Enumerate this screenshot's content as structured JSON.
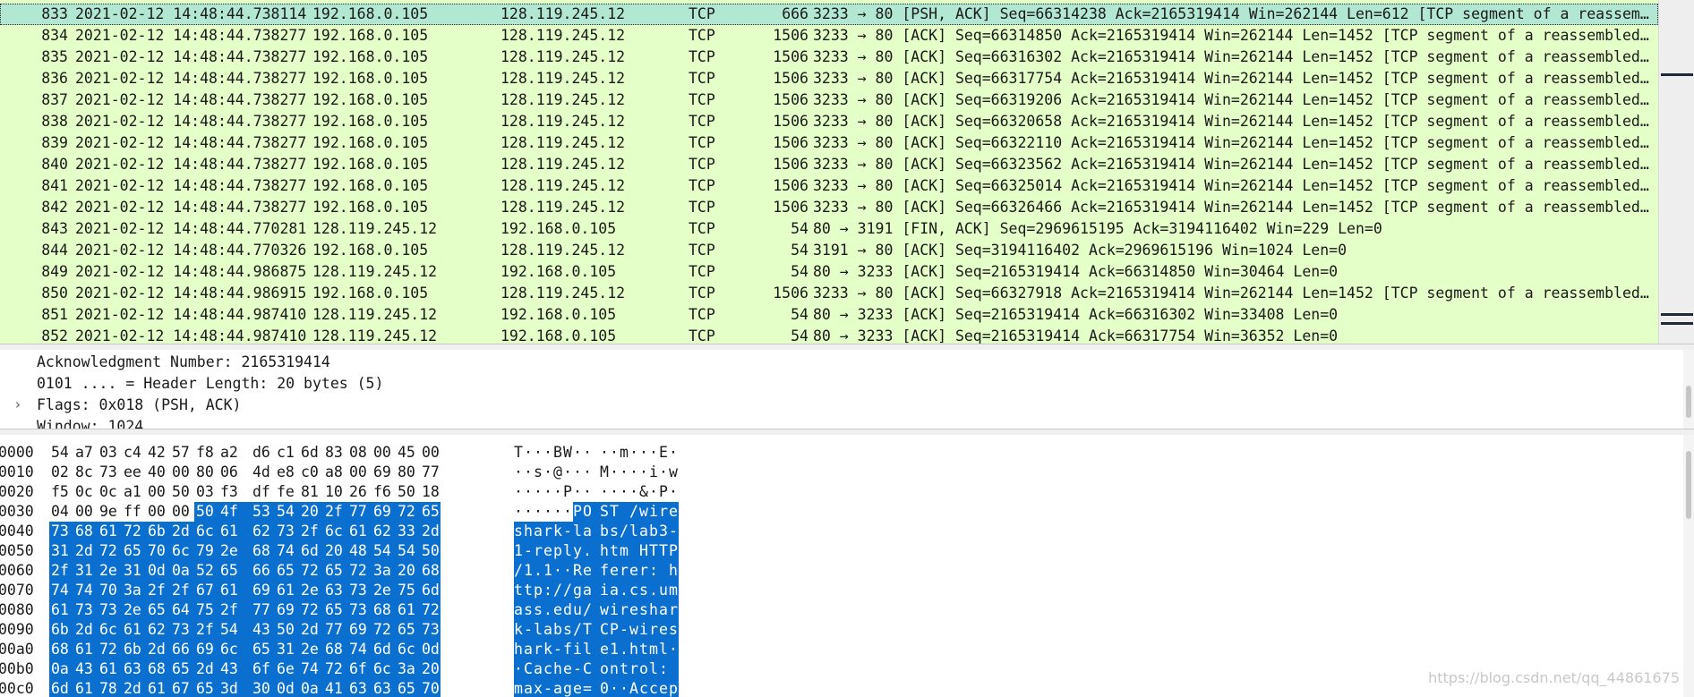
{
  "packet_list": {
    "rows": [
      {
        "no": "833",
        "time": "2021-02-12 14:48:44.738114",
        "src": "192.168.0.105",
        "dst": "128.119.245.12",
        "proto": "TCP",
        "len": "666",
        "info": "3233 → 80 [PSH, ACK] Seq=66314238 Ack=2165319414 Win=262144 Len=612 [TCP segment of a reassem…",
        "selected": true
      },
      {
        "no": "834",
        "time": "2021-02-12 14:48:44.738277",
        "src": "192.168.0.105",
        "dst": "128.119.245.12",
        "proto": "TCP",
        "len": "1506",
        "info": "3233 → 80 [ACK] Seq=66314850 Ack=2165319414 Win=262144 Len=1452 [TCP segment of a reassembled…",
        "selected": false
      },
      {
        "no": "835",
        "time": "2021-02-12 14:48:44.738277",
        "src": "192.168.0.105",
        "dst": "128.119.245.12",
        "proto": "TCP",
        "len": "1506",
        "info": "3233 → 80 [ACK] Seq=66316302 Ack=2165319414 Win=262144 Len=1452 [TCP segment of a reassembled…",
        "selected": false
      },
      {
        "no": "836",
        "time": "2021-02-12 14:48:44.738277",
        "src": "192.168.0.105",
        "dst": "128.119.245.12",
        "proto": "TCP",
        "len": "1506",
        "info": "3233 → 80 [ACK] Seq=66317754 Ack=2165319414 Win=262144 Len=1452 [TCP segment of a reassembled…",
        "selected": false
      },
      {
        "no": "837",
        "time": "2021-02-12 14:48:44.738277",
        "src": "192.168.0.105",
        "dst": "128.119.245.12",
        "proto": "TCP",
        "len": "1506",
        "info": "3233 → 80 [ACK] Seq=66319206 Ack=2165319414 Win=262144 Len=1452 [TCP segment of a reassembled…",
        "selected": false
      },
      {
        "no": "838",
        "time": "2021-02-12 14:48:44.738277",
        "src": "192.168.0.105",
        "dst": "128.119.245.12",
        "proto": "TCP",
        "len": "1506",
        "info": "3233 → 80 [ACK] Seq=66320658 Ack=2165319414 Win=262144 Len=1452 [TCP segment of a reassembled…",
        "selected": false
      },
      {
        "no": "839",
        "time": "2021-02-12 14:48:44.738277",
        "src": "192.168.0.105",
        "dst": "128.119.245.12",
        "proto": "TCP",
        "len": "1506",
        "info": "3233 → 80 [ACK] Seq=66322110 Ack=2165319414 Win=262144 Len=1452 [TCP segment of a reassembled…",
        "selected": false
      },
      {
        "no": "840",
        "time": "2021-02-12 14:48:44.738277",
        "src": "192.168.0.105",
        "dst": "128.119.245.12",
        "proto": "TCP",
        "len": "1506",
        "info": "3233 → 80 [ACK] Seq=66323562 Ack=2165319414 Win=262144 Len=1452 [TCP segment of a reassembled…",
        "selected": false
      },
      {
        "no": "841",
        "time": "2021-02-12 14:48:44.738277",
        "src": "192.168.0.105",
        "dst": "128.119.245.12",
        "proto": "TCP",
        "len": "1506",
        "info": "3233 → 80 [ACK] Seq=66325014 Ack=2165319414 Win=262144 Len=1452 [TCP segment of a reassembled…",
        "selected": false
      },
      {
        "no": "842",
        "time": "2021-02-12 14:48:44.738277",
        "src": "192.168.0.105",
        "dst": "128.119.245.12",
        "proto": "TCP",
        "len": "1506",
        "info": "3233 → 80 [ACK] Seq=66326466 Ack=2165319414 Win=262144 Len=1452 [TCP segment of a reassembled…",
        "selected": false
      },
      {
        "no": "843",
        "time": "2021-02-12 14:48:44.770281",
        "src": "128.119.245.12",
        "dst": "192.168.0.105",
        "proto": "TCP",
        "len": "54",
        "info": "80 → 3191 [FIN, ACK] Seq=2969615195 Ack=3194116402 Win=229 Len=0",
        "selected": false
      },
      {
        "no": "844",
        "time": "2021-02-12 14:48:44.770326",
        "src": "192.168.0.105",
        "dst": "128.119.245.12",
        "proto": "TCP",
        "len": "54",
        "info": "3191 → 80 [ACK] Seq=3194116402 Ack=2969615196 Win=1024 Len=0",
        "selected": false
      },
      {
        "no": "849",
        "time": "2021-02-12 14:48:44.986875",
        "src": "128.119.245.12",
        "dst": "192.168.0.105",
        "proto": "TCP",
        "len": "54",
        "info": "80 → 3233 [ACK] Seq=2165319414 Ack=66314850 Win=30464 Len=0",
        "selected": false
      },
      {
        "no": "850",
        "time": "2021-02-12 14:48:44.986915",
        "src": "192.168.0.105",
        "dst": "128.119.245.12",
        "proto": "TCP",
        "len": "1506",
        "info": "3233 → 80 [ACK] Seq=66327918 Ack=2165319414 Win=262144 Len=1452 [TCP segment of a reassembled…",
        "selected": false
      },
      {
        "no": "851",
        "time": "2021-02-12 14:48:44.987410",
        "src": "128.119.245.12",
        "dst": "192.168.0.105",
        "proto": "TCP",
        "len": "54",
        "info": "80 → 3233 [ACK] Seq=2165319414 Ack=66316302 Win=33408 Len=0",
        "selected": false
      },
      {
        "no": "852",
        "time": "2021-02-12 14:48:44.987410",
        "src": "128.119.245.12",
        "dst": "192.168.0.105",
        "proto": "TCP",
        "len": "54",
        "info": "80 → 3233 [ACK] Seq=2165319414 Ack=66317754 Win=36352 Len=0",
        "selected": false
      }
    ]
  },
  "details": {
    "lines": [
      {
        "text": "Acknowledgment Number: 2165319414",
        "expander": ""
      },
      {
        "text": "0101 .... = Header Length: 20 bytes (5)",
        "expander": ""
      },
      {
        "text": "Flags: 0x018 (PSH, ACK)",
        "expander": "›"
      },
      {
        "text": "Window: 1024",
        "expander": ""
      }
    ]
  },
  "bytes": {
    "rows": [
      {
        "offset": "0000",
        "hex": [
          "54",
          "a7",
          "03",
          "c4",
          "42",
          "57",
          "f8",
          "a2",
          "d6",
          "c1",
          "6d",
          "83",
          "08",
          "00",
          "45",
          "00"
        ],
        "ascii": [
          "T",
          "·",
          "·",
          "·",
          "B",
          "W",
          "·",
          "·",
          "·",
          "·",
          "m",
          "·",
          "·",
          "·",
          "E",
          "·"
        ],
        "hl_start": 16
      },
      {
        "offset": "0010",
        "hex": [
          "02",
          "8c",
          "73",
          "ee",
          "40",
          "00",
          "80",
          "06",
          "4d",
          "e8",
          "c0",
          "a8",
          "00",
          "69",
          "80",
          "77"
        ],
        "ascii": [
          "·",
          "·",
          "s",
          "·",
          "@",
          "·",
          "·",
          "·",
          "M",
          "·",
          "·",
          "·",
          "·",
          "i",
          "·",
          "w"
        ],
        "hl_start": 16
      },
      {
        "offset": "0020",
        "hex": [
          "f5",
          "0c",
          "0c",
          "a1",
          "00",
          "50",
          "03",
          "f3",
          "df",
          "fe",
          "81",
          "10",
          "26",
          "f6",
          "50",
          "18"
        ],
        "ascii": [
          "·",
          "·",
          "·",
          "·",
          "·",
          "P",
          "·",
          "·",
          "·",
          "·",
          "·",
          "·",
          "&",
          "·",
          "P",
          "·"
        ],
        "hl_start": 16
      },
      {
        "offset": "0030",
        "hex": [
          "04",
          "00",
          "9e",
          "ff",
          "00",
          "00",
          "50",
          "4f",
          "53",
          "54",
          "20",
          "2f",
          "77",
          "69",
          "72",
          "65"
        ],
        "ascii": [
          "·",
          "·",
          "·",
          "·",
          "·",
          "·",
          "P",
          "O",
          "S",
          "T",
          " ",
          "/",
          "w",
          "i",
          "r",
          "e"
        ],
        "hl_start": 6
      },
      {
        "offset": "0040",
        "hex": [
          "73",
          "68",
          "61",
          "72",
          "6b",
          "2d",
          "6c",
          "61",
          "62",
          "73",
          "2f",
          "6c",
          "61",
          "62",
          "33",
          "2d"
        ],
        "ascii": [
          "s",
          "h",
          "a",
          "r",
          "k",
          "-",
          "l",
          "a",
          "b",
          "s",
          "/",
          "l",
          "a",
          "b",
          "3",
          "-"
        ],
        "hl_start": 0
      },
      {
        "offset": "0050",
        "hex": [
          "31",
          "2d",
          "72",
          "65",
          "70",
          "6c",
          "79",
          "2e",
          "68",
          "74",
          "6d",
          "20",
          "48",
          "54",
          "54",
          "50"
        ],
        "ascii": [
          "1",
          "-",
          "r",
          "e",
          "p",
          "l",
          "y",
          ".",
          "h",
          "t",
          "m",
          " ",
          "H",
          "T",
          "T",
          "P"
        ],
        "hl_start": 0
      },
      {
        "offset": "0060",
        "hex": [
          "2f",
          "31",
          "2e",
          "31",
          "0d",
          "0a",
          "52",
          "65",
          "66",
          "65",
          "72",
          "65",
          "72",
          "3a",
          "20",
          "68"
        ],
        "ascii": [
          "/",
          "1",
          ".",
          "1",
          "·",
          "·",
          "R",
          "e",
          "f",
          "e",
          "r",
          "e",
          "r",
          ":",
          " ",
          "h"
        ],
        "hl_start": 0
      },
      {
        "offset": "0070",
        "hex": [
          "74",
          "74",
          "70",
          "3a",
          "2f",
          "2f",
          "67",
          "61",
          "69",
          "61",
          "2e",
          "63",
          "73",
          "2e",
          "75",
          "6d"
        ],
        "ascii": [
          "t",
          "t",
          "p",
          ":",
          "/",
          "/",
          "g",
          "a",
          "i",
          "a",
          ".",
          "c",
          "s",
          ".",
          "u",
          "m"
        ],
        "hl_start": 0
      },
      {
        "offset": "0080",
        "hex": [
          "61",
          "73",
          "73",
          "2e",
          "65",
          "64",
          "75",
          "2f",
          "77",
          "69",
          "72",
          "65",
          "73",
          "68",
          "61",
          "72"
        ],
        "ascii": [
          "a",
          "s",
          "s",
          ".",
          "e",
          "d",
          "u",
          "/",
          "w",
          "i",
          "r",
          "e",
          "s",
          "h",
          "a",
          "r"
        ],
        "hl_start": 0
      },
      {
        "offset": "0090",
        "hex": [
          "6b",
          "2d",
          "6c",
          "61",
          "62",
          "73",
          "2f",
          "54",
          "43",
          "50",
          "2d",
          "77",
          "69",
          "72",
          "65",
          "73"
        ],
        "ascii": [
          "k",
          "-",
          "l",
          "a",
          "b",
          "s",
          "/",
          "T",
          "C",
          "P",
          "-",
          "w",
          "i",
          "r",
          "e",
          "s"
        ],
        "hl_start": 0
      },
      {
        "offset": "00a0",
        "hex": [
          "68",
          "61",
          "72",
          "6b",
          "2d",
          "66",
          "69",
          "6c",
          "65",
          "31",
          "2e",
          "68",
          "74",
          "6d",
          "6c",
          "0d"
        ],
        "ascii": [
          "h",
          "a",
          "r",
          "k",
          "-",
          "f",
          "i",
          "l",
          "e",
          "1",
          ".",
          "h",
          "t",
          "m",
          "l",
          "·"
        ],
        "hl_start": 0
      },
      {
        "offset": "00b0",
        "hex": [
          "0a",
          "43",
          "61",
          "63",
          "68",
          "65",
          "2d",
          "43",
          "6f",
          "6e",
          "74",
          "72",
          "6f",
          "6c",
          "3a",
          "20"
        ],
        "ascii": [
          "·",
          "C",
          "a",
          "c",
          "h",
          "e",
          "-",
          "C",
          "o",
          "n",
          "t",
          "r",
          "o",
          "l",
          ":",
          " "
        ],
        "hl_start": 0
      },
      {
        "offset": "00c0",
        "hex": [
          "6d",
          "61",
          "78",
          "2d",
          "61",
          "67",
          "65",
          "3d",
          "30",
          "0d",
          "0a",
          "41",
          "63",
          "63",
          "65",
          "70"
        ],
        "ascii": [
          "m",
          "a",
          "x",
          "-",
          "a",
          "g",
          "e",
          "=",
          "0",
          "·",
          "·",
          "A",
          "c",
          "c",
          "e",
          "p"
        ],
        "hl_start": 0
      }
    ]
  },
  "watermark": "https://blog.csdn.net/qq_44861675",
  "colors": {
    "list_bg": "#e4ffc7",
    "selected_bg": "#b2e7d3",
    "highlight": "#0b6fd0"
  }
}
